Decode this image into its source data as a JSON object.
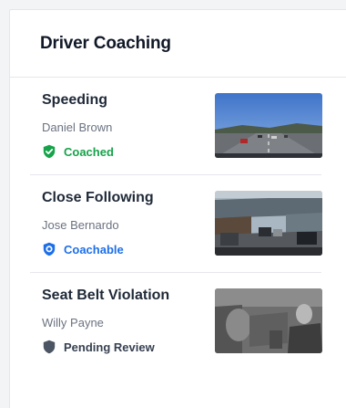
{
  "header": {
    "title": "Driver Coaching"
  },
  "events": [
    {
      "title": "Speeding",
      "driver": "Daniel Brown",
      "status": "Coached",
      "status_color": "#16a34a",
      "status_icon": "shield-check-icon",
      "thumbnail": "highway-dashcam-thumbnail"
    },
    {
      "title": "Close Following",
      "driver": "Jose Bernardo",
      "status": "Coachable",
      "status_color": "#1d6fe8",
      "status_icon": "shield-dot-icon",
      "thumbnail": "traffic-dashcam-thumbnail"
    },
    {
      "title": "Seat Belt Violation",
      "driver": "Willy Payne",
      "status": "Pending Review",
      "status_color": "#374151",
      "status_icon": "shield-icon",
      "thumbnail": "cabin-camera-thumbnail"
    }
  ]
}
